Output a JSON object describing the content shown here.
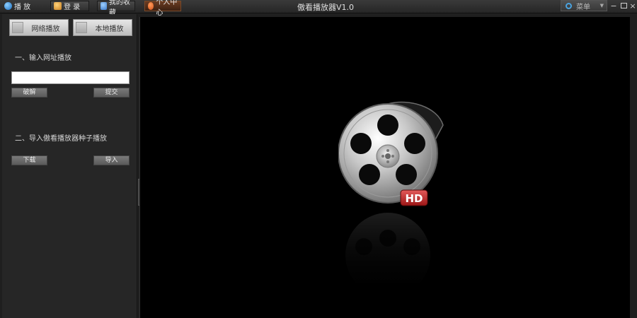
{
  "toolbar": {
    "play_label": "播 放",
    "login_label": "登 录",
    "favorites_label": "我的收藏",
    "user_center_label": "个人中心"
  },
  "app_title": "傲看播放器V1.0",
  "menu_label": "菜单",
  "left_panel": {
    "tab_network": "网络播放",
    "tab_local": "本地播放",
    "section1_title": "一、输入网址播放",
    "url_input_value": "",
    "parse_button": "破解",
    "submit_button": "提交",
    "section2_title": "二、导入傲看播放器种子播放",
    "download_button": "下载",
    "import_button": "导入"
  },
  "logo": {
    "badge_text": "HD"
  },
  "icons": {
    "play": "globe-icon",
    "login": "user-icon",
    "favorites": "users-icon",
    "user_center": "heart-icon",
    "menu": "ring-icon",
    "collapse": "chevron-left-icon"
  },
  "colors": {
    "background": "#1f1f1f",
    "video_bg": "#000000",
    "accent_blue": "#4aa3e0",
    "badge_red": "#c62828"
  }
}
